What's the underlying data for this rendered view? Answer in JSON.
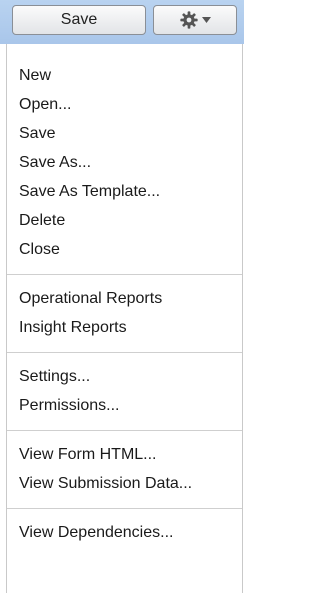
{
  "toolbar": {
    "save_label": "Save",
    "gear_icon": "gear-icon",
    "caret_icon": "chevron-down-icon"
  },
  "menu": {
    "groups": [
      {
        "items": [
          "New",
          "Open...",
          "Save",
          "Save As...",
          "Save As Template...",
          "Delete",
          "Close"
        ]
      },
      {
        "items": [
          "Operational Reports",
          "Insight Reports"
        ]
      },
      {
        "items": [
          "Settings...",
          "Permissions..."
        ]
      },
      {
        "items": [
          "View Form HTML...",
          "View Submission Data..."
        ]
      },
      {
        "items": [
          "View Dependencies..."
        ]
      }
    ]
  },
  "colors": {
    "toolbar_background": "#b9d3f0",
    "separator": "#cfcfcf",
    "text": "#1a1a1a"
  }
}
